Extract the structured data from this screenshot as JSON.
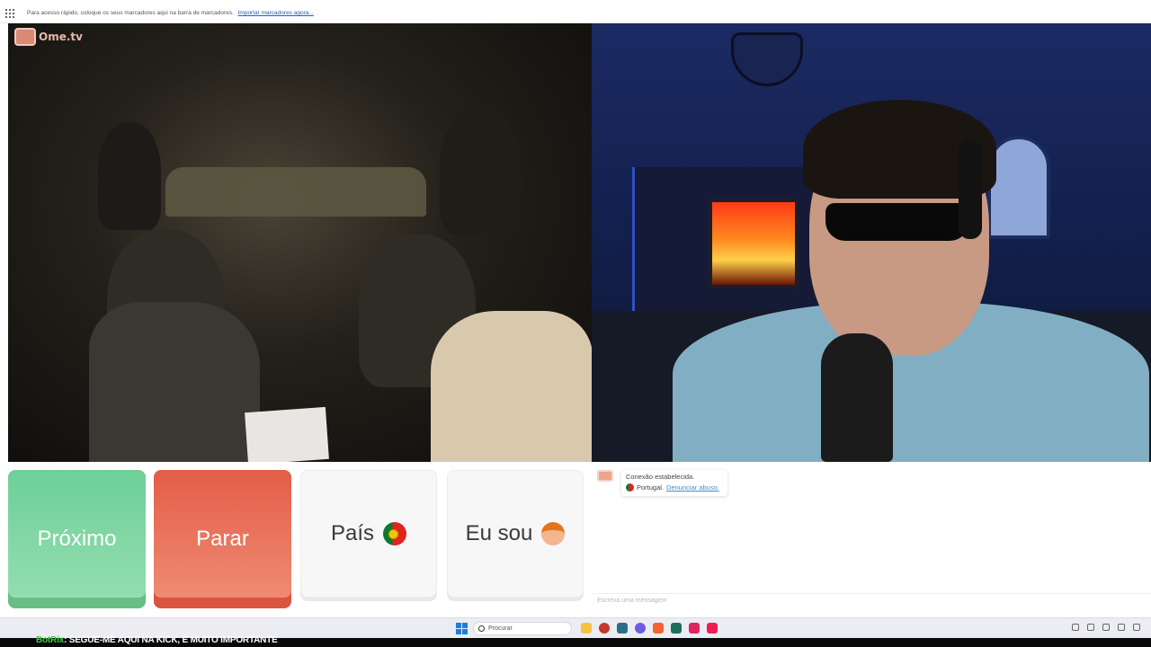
{
  "browser": {
    "bookmarks_bar_text": "Para acesso rápido, coloque os seus marcadores aqui na barra de marcadores.",
    "bookmarks_bar_link": "Importar marcadores agora..."
  },
  "app": {
    "logo_text": "Ome.tv"
  },
  "controls": {
    "next_label": "Próximo",
    "stop_label": "Parar",
    "country_label": "País",
    "gender_label": "Eu sou"
  },
  "chat": {
    "status_message": "Conexão estabelecida.",
    "country_name": "Portugal.",
    "report_link": "Denunciar abuso.",
    "input_placeholder": "Escreva uma mensagem"
  },
  "taskbar": {
    "search_placeholder": "Procurar"
  },
  "ticker": {
    "bot_name": "BotRix",
    "message": ": SEGUE-ME AQUI NA KICK, É MUITO IMPORTANTE"
  },
  "colors": {
    "next_button": "#6dcf98",
    "stop_button": "#e45d47",
    "link": "#3f8fd0"
  },
  "icons": [
    "apps-grid-icon",
    "ometv-logo-icon",
    "portugal-flag-icon",
    "boy-emoji-icon",
    "windows-start-icon",
    "search-icon"
  ]
}
